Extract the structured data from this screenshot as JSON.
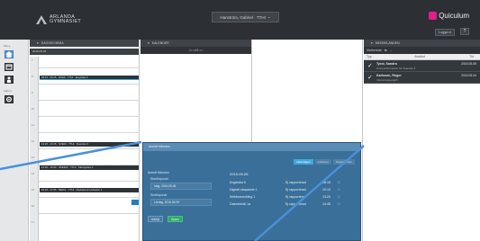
{
  "top_strip": "",
  "logo": {
    "line1": "ARLANDA",
    "line2": "GYMNASIET"
  },
  "user_menu": {
    "label": "Hanström, Gabriel · TTHI",
    "chevron": "⌄"
  },
  "brand": {
    "name": "Quiculum"
  },
  "logout_label": "Logga ut",
  "help_label": "?",
  "rail": {
    "top_label": "Meny",
    "mid_label": "Admin"
  },
  "day_column": {
    "header": "DAGSSCHEMA",
    "date": "2015-05-06",
    "hours": [
      "7",
      "8",
      "9",
      "10",
      "11",
      "12",
      "13",
      "14",
      "15",
      "16",
      "17"
    ],
    "lessons": [
      {
        "label": "08:15 - 09:15 · ENG6 · TTHI · Engelska 6"
      },
      {
        "label": "13:20 - 14:15 · SVE03 · TTHI · Svenska 3"
      },
      {
        "label": "14:30 - 15:30 · NKEK02 · TTHI · Näringslära 1"
      },
      {
        "label": "16:15 - 17:05 · MEDI1 · TTHI · Mediekommunikation 1"
      }
    ]
  },
  "calendar_column": {
    "header": "KALENDER",
    "nav": "<<   v19   >>"
  },
  "messages_column": {
    "header": "MEDDELANDEN",
    "tools": [
      "Markerade",
      "⇆",
      "⌄"
    ],
    "tab_type": "Typ",
    "tab_sender": "Avsänd",
    "tab_date": "Tid",
    "messages": [
      {
        "from": "Tyrol, Sandra",
        "subject": "Ämnesinformation för Svenska 3",
        "date": "2015-05-05"
      },
      {
        "from": "Karlsson, Roger",
        "subject": "Inlämningsuppgift",
        "date": "2015-05-04"
      }
    ]
  },
  "dialog": {
    "title": "Anmäl frånvaro",
    "tabs": [
      "Hela dagen",
      "Lektioner",
      "Dagsfrånvaro"
    ],
    "section_label": "Anmäl frånvaro",
    "start_label": "Starttidpunkt",
    "start_value": "Idag, 2015-05-06",
    "end_label": "Sluttidpunkt",
    "end_value": "Lördag, 2015-05-09",
    "cancel_label": "Avbryt",
    "save_label": "Spara",
    "date_heading": "2015-05-06",
    "rows": [
      {
        "course": "Engelska 6",
        "status": "Ej rapporterad",
        "time": "08:15",
        "icon": "□"
      },
      {
        "course": "Digitalt skapande 1",
        "status": "Ej rapporterad",
        "time": "10:10",
        "icon": "□"
      },
      {
        "course": "Webbutveckling 1",
        "status": "Ej rapporterad",
        "time": "13:20",
        "icon": "□"
      },
      {
        "course": "Datorteknik 1a",
        "status": "Ej rapporterad",
        "time": "14:45",
        "icon": "□"
      }
    ]
  },
  "colors": {
    "topbar": "#2c2f33",
    "dialog": "#3a6f99",
    "accent_cyan": "#35b0e0",
    "brand": "#e11d8a",
    "save_green": "#2fa86a"
  },
  "icons": [
    "home-icon",
    "calendar-icon",
    "user-icon",
    "gear-icon",
    "checkmark-icon"
  ]
}
